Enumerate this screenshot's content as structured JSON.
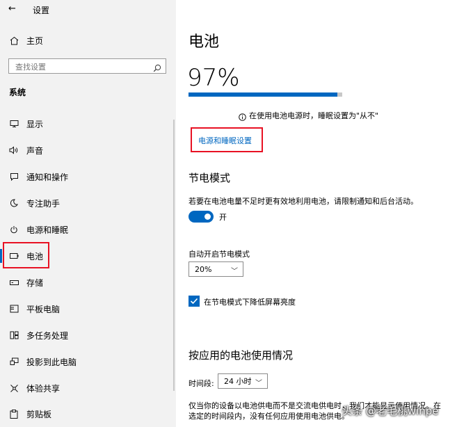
{
  "window": {
    "title": "设置",
    "back_icon": "←"
  },
  "sidebar": {
    "home": "主页",
    "search": {
      "placeholder": "查找设置"
    },
    "section": "系统",
    "items": [
      {
        "label": "显示",
        "icon": "monitor-icon"
      },
      {
        "label": "声音",
        "icon": "speaker-icon"
      },
      {
        "label": "通知和操作",
        "icon": "message-icon"
      },
      {
        "label": "专注助手",
        "icon": "moon-icon"
      },
      {
        "label": "电源和睡眠",
        "icon": "power-icon"
      },
      {
        "label": "电池",
        "icon": "battery-icon",
        "selected": true
      },
      {
        "label": "存储",
        "icon": "storage-icon"
      },
      {
        "label": "平板电脑",
        "icon": "tablet-icon"
      },
      {
        "label": "多任务处理",
        "icon": "multitask-icon"
      },
      {
        "label": "投影到此电脑",
        "icon": "project-icon"
      },
      {
        "label": "体验共享",
        "icon": "share-icon"
      },
      {
        "label": "剪贴板",
        "icon": "clipboard-icon"
      }
    ]
  },
  "main": {
    "title": "电池",
    "percent": "97%",
    "charge_fraction": 0.97,
    "info_note": "在使用电池电源时，睡眠设置为\"从不\"",
    "power_sleep_link": "电源和睡眠设置",
    "saver": {
      "heading": "节电模式",
      "description": "若要在电池电量不足时更有效地利用电池，请限制通知和后台活动。",
      "toggle_label": "开",
      "auto_label": "自动开启节电模式",
      "auto_value": "20%",
      "lower_brightness": "在节电模式下降低屏幕亮度"
    },
    "usage": {
      "heading": "按应用的电池使用情况",
      "period_label": "时间段:",
      "period_value": "24 小时",
      "note_line1": "仅当你的设备以电池供电而不是交流电供电时，我们才能显示使用情况。在",
      "note_line2": "选定的时间段内，没有任何应用使用电池供电。"
    }
  },
  "watermark": "头条 @老毛桃winpe",
  "colors": {
    "accent": "#0067c0",
    "highlight": "#e81123",
    "sidebar_bg": "#f2f2f2"
  }
}
